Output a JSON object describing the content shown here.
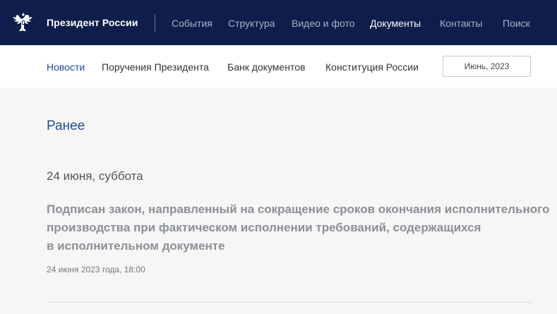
{
  "header": {
    "brand": "Президент России",
    "nav": [
      {
        "label": "События",
        "active": false
      },
      {
        "label": "Структура",
        "active": false
      },
      {
        "label": "Видео и фото",
        "active": false
      },
      {
        "label": "Документы",
        "active": true
      },
      {
        "label": "Контакты",
        "active": false
      },
      {
        "label": "Поиск",
        "active": false
      }
    ],
    "emblem_icon": "double-headed-eagle-icon",
    "colors": {
      "background": "#0e1d4a",
      "active": "#ffffff",
      "inactive": "#aab3cc"
    }
  },
  "subnav": {
    "items": [
      {
        "label": "Новости",
        "active": true
      },
      {
        "label": "Поручения Президента",
        "active": false
      },
      {
        "label": "Банк документов",
        "active": false
      },
      {
        "label": "Конституция России",
        "active": false
      }
    ],
    "date_selector": "Июнь, 2023",
    "colors": {
      "active": "#1f4b99"
    }
  },
  "main": {
    "earlier_link": "Ранее",
    "day_heading": "24 июня, суббота",
    "article": {
      "title_lines": [
        "Подписан закон, направленный на сокращение сроков окончания исполнительного",
        "производства при фактическом исполнении требований, содержащихся",
        "в исполнительном документе"
      ],
      "timestamp": "24 июня 2023 года, 18:00"
    }
  }
}
